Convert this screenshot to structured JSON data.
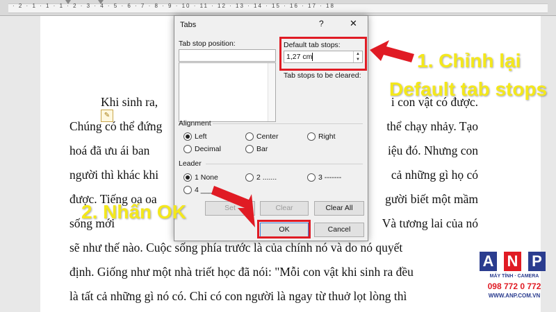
{
  "ruler": {
    "text": "· 2 · 1 · 1 · 1 · 2 · 3 · 4 · 5 · 6 · 7 · 8 · 9 · 10 · 11 · 12 · 13 · 14 · 15 · 16 · 17 · 18"
  },
  "document": {
    "lines": [
      "Khi sinh ra,",
      "Chúng có thể đứng",
      "hoá đã ưu ái ban",
      "người thì khác khi",
      "được. Tiếng oa oa",
      "sống mới",
      "sẽ như thế nào. Cuộc sống phía trước là của chính nó và do nó quyết",
      "định. Giống như một nhà triết học đã nói: \"Mỗi con vật khi sinh ra đều",
      "là tất cả những gì nó có. Chỉ có con người là ngay từ thuở lọt lòng thì"
    ],
    "right_fragments": [
      "i con vật có được.",
      "thể chạy nhảy. Tạo",
      "iệu đó. Nhưng con",
      "cả những gì họ có",
      "gười biết một mầm",
      "Và tương lai của nó"
    ]
  },
  "dialog": {
    "title": "Tabs",
    "help": "?",
    "close": "✕",
    "tab_stop_position_label": "Tab stop position:",
    "tab_stop_position_value": "",
    "default_tab_stops_label": "Default tab stops:",
    "default_tab_stops_value": "1,27 cm",
    "tab_stops_to_be_cleared_label": "Tab stops to be cleared:",
    "alignment_label": "Alignment",
    "alignment_options": [
      "Left",
      "Center",
      "Right",
      "Decimal",
      "Bar"
    ],
    "leader_label": "Leader",
    "leader_options": [
      "1 None",
      "2 .......",
      "3 -------",
      "4 ____"
    ],
    "set_label": "Set",
    "clear_label": "Clear",
    "clear_all_label": "Clear All",
    "ok_label": "OK",
    "cancel_label": "Cancel"
  },
  "annotations": {
    "step1_line1": "1. Chỉnh lại",
    "step1_line2": "Default tab stops",
    "step2": "2. Nhấn OK"
  },
  "logo": {
    "letters": [
      "A",
      "N",
      "P"
    ],
    "phone": "098 772 0 772",
    "tagline": "MÁY TÍNH · CAMERA",
    "site": "WWW.ANP.COM.VN"
  },
  "colors": {
    "highlight": "#e01b24",
    "callout_text": "#f4e81b",
    "arrow": "#e01b24",
    "logo_blue": "#2b3d8f",
    "logo_red": "#e01b24"
  }
}
